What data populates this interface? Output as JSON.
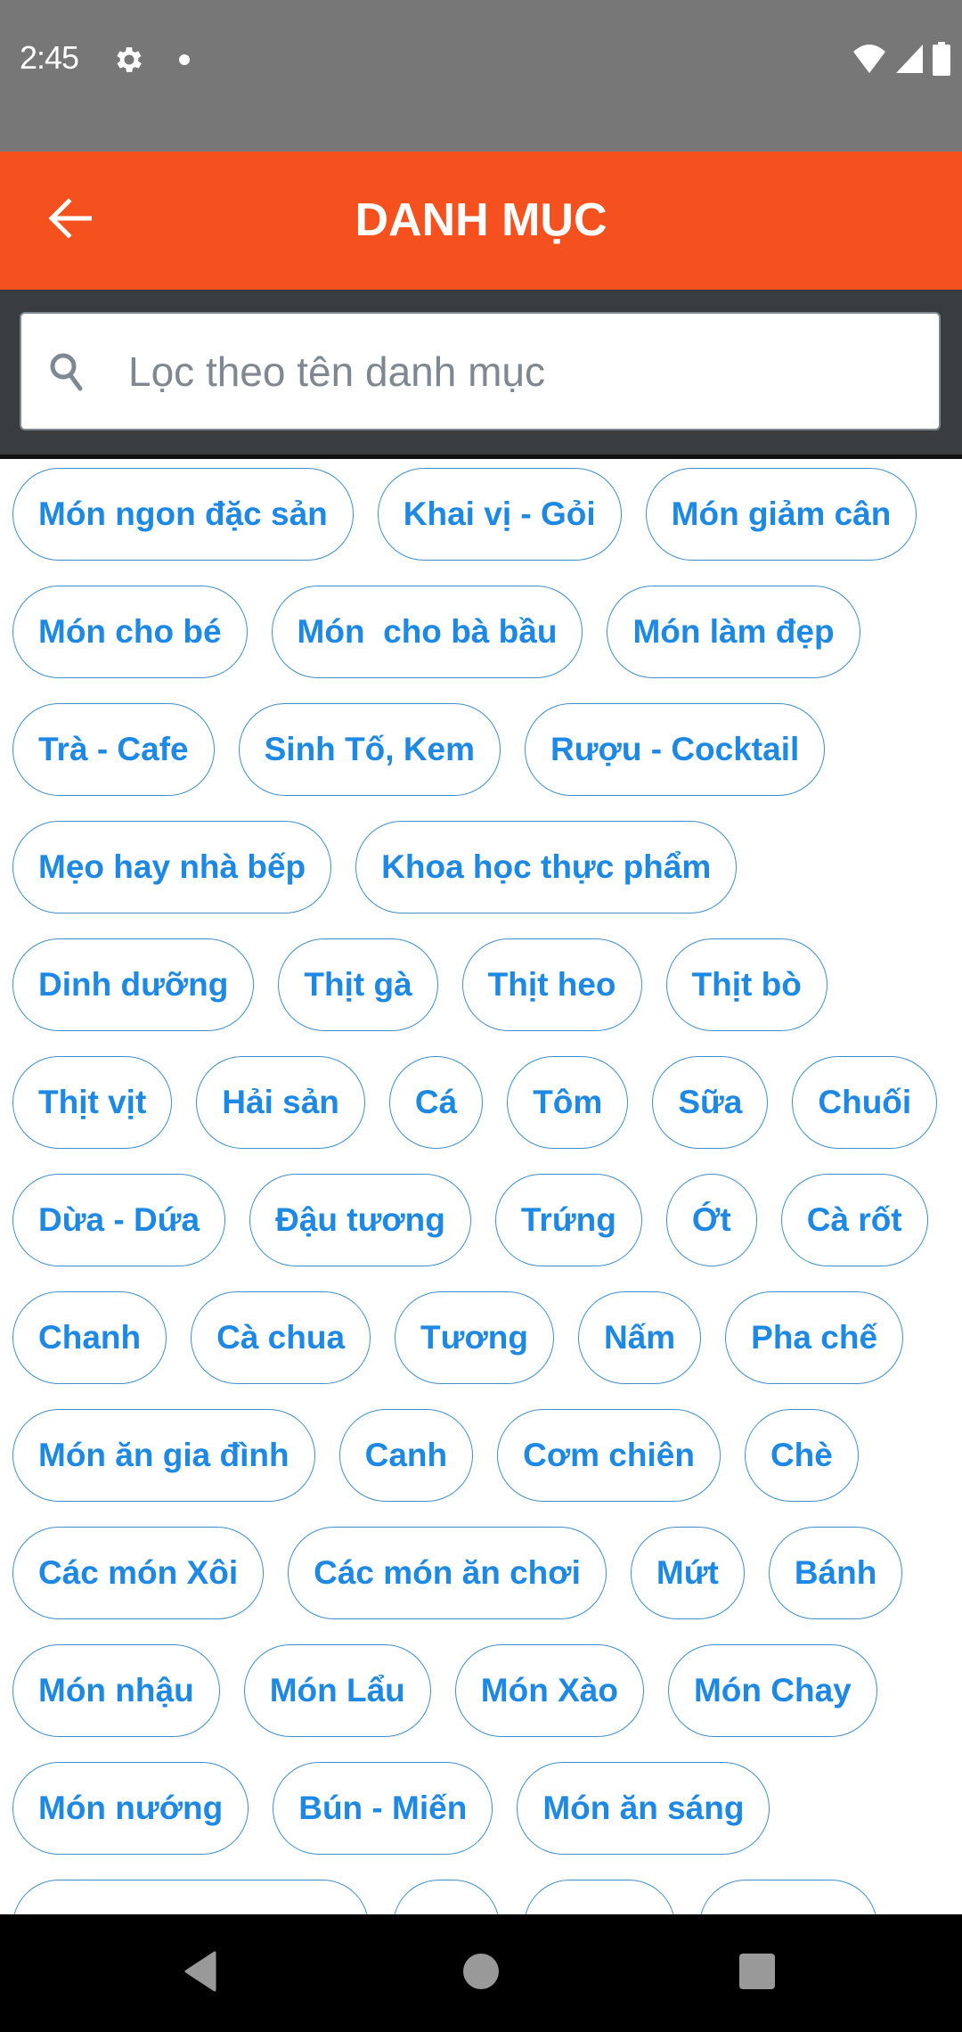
{
  "status_bar": {
    "time": "2:45",
    "left_icons": [
      "settings-gear-icon",
      "notification-dot-icon"
    ],
    "right_icons": [
      "wifi-icon",
      "cellular-signal-icon",
      "battery-icon"
    ]
  },
  "toolbar": {
    "back_icon": "arrow-left-icon",
    "title": "DANH MỤC",
    "background_color": "#F4511E"
  },
  "search": {
    "icon": "search-icon",
    "value": "",
    "placeholder": "Lọc theo tên danh mục"
  },
  "categories": {
    "chip_text_color": "#1E88E5",
    "chip_border_color": "#3F8FCD",
    "rows": [
      [
        "Món ngon đặc sản",
        "Khai vị - Gỏi",
        "Món giảm cân"
      ],
      [
        "Món cho bé",
        "Món  cho bà bầu",
        "Món làm đẹp"
      ],
      [
        "Trà - Cafe",
        "Sinh Tố, Kem",
        "Rượu - Cocktail"
      ],
      [
        "Mẹo hay nhà bếp",
        "Khoa học thực phẩm"
      ],
      [
        "Dinh dưỡng",
        "Thịt gà",
        "Thịt heo",
        "Thịt bò"
      ],
      [
        "Thịt vịt",
        "Hải sản",
        "Cá",
        "Tôm",
        "Sữa",
        "Chuối"
      ],
      [
        "Dừa - Dứa",
        "Đậu tương",
        "Trứng",
        "Ớt",
        "Cà rốt"
      ],
      [
        "Chanh",
        "Cà chua",
        "Tương",
        "Nấm",
        "Pha chế"
      ],
      [
        "Món ăn gia đình",
        "Canh",
        "Cơm chiên",
        "Chè"
      ],
      [
        "Các món Xôi",
        "Các món ăn chơi",
        "Mứt",
        "Bánh"
      ],
      [
        "Món nhậu",
        "Món Lẩu",
        "Món Xào",
        "Món Chay"
      ],
      [
        "Món nướng",
        "Bún - Miến",
        "Món ăn sáng"
      ]
    ],
    "partially_visible_row_count": 4
  },
  "nav_bar": {
    "buttons": [
      "back-triangle-icon",
      "home-circle-icon",
      "recents-square-icon"
    ]
  }
}
